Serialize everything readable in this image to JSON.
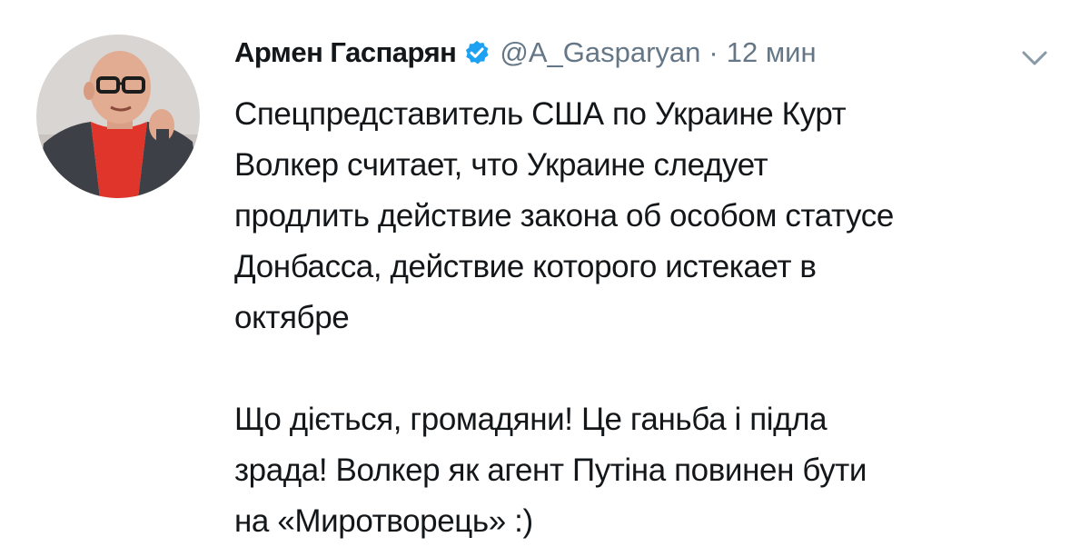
{
  "tweet": {
    "author": {
      "display_name": "Армен Гаспарян",
      "handle": "@A_Gasparyan",
      "verified": true
    },
    "separator": "·",
    "timestamp": "12 мин",
    "text_lines": [
      "Спецпредставитель США по Украине Курт",
      "Волкер считает, что Украине следует",
      "продлить действие закона об особом статусе",
      "Донбасса, действие которого истекает в",
      "октябре",
      "",
      "Що діється, громадяни! Це ганьба і підла",
      "зрада! Волкер як агент Путіна повинен бути",
      "на «Миротворець» :)"
    ]
  },
  "icons": {
    "verified": "verified-badge-icon",
    "caret": "chevron-down-icon"
  },
  "colors": {
    "text_primary": "#14171a",
    "text_secondary": "#657786",
    "verified_blue": "#1da1f2"
  }
}
